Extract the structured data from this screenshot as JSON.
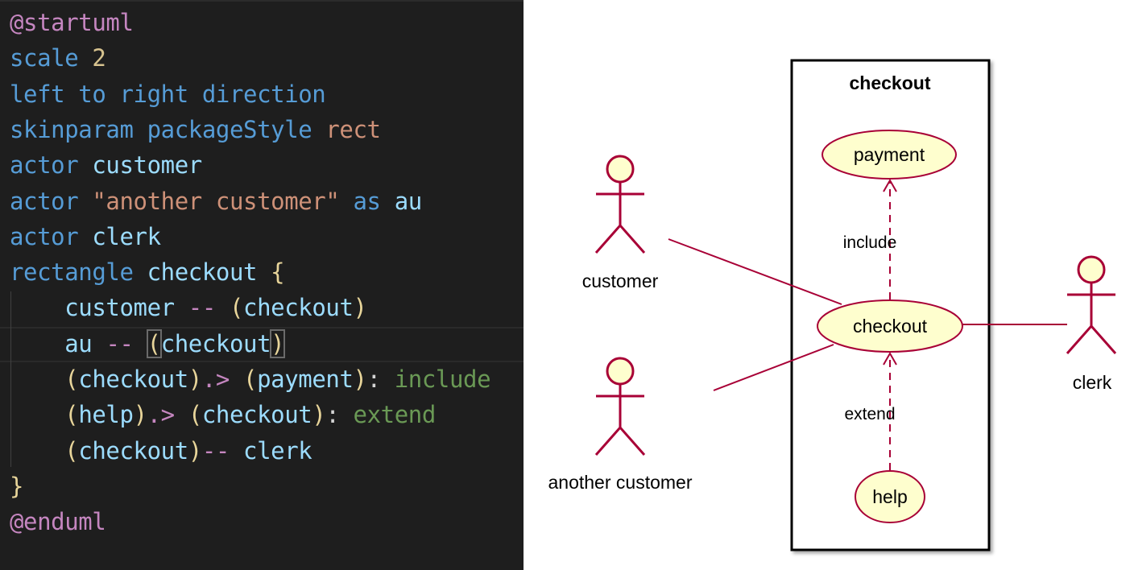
{
  "editor": {
    "lines": [
      [
        [
          "a",
          "@startuml"
        ]
      ],
      [
        [
          "k",
          "scale "
        ],
        [
          "n",
          "2"
        ]
      ],
      [
        [
          "k",
          "left to right direction"
        ]
      ],
      [
        [
          "k",
          "skinparam packageStyle "
        ],
        [
          "s",
          "rect"
        ]
      ],
      [
        [
          "k",
          "actor "
        ],
        [
          "v",
          "customer"
        ]
      ],
      [
        [
          "k",
          "actor "
        ],
        [
          "s",
          "\"another customer\" "
        ],
        [
          "k",
          "as "
        ],
        [
          "v",
          "au"
        ]
      ],
      [
        [
          "k",
          "actor "
        ],
        [
          "v",
          "clerk"
        ]
      ],
      [
        [
          "k",
          "rectangle "
        ],
        [
          "v",
          "checkout "
        ],
        [
          "p",
          "{"
        ]
      ],
      [
        [
          "w",
          "    "
        ],
        [
          "v",
          "customer "
        ],
        [
          "o",
          "-- "
        ],
        [
          "p",
          "("
        ],
        [
          "v",
          "checkout"
        ],
        [
          "p",
          ")"
        ]
      ],
      [
        [
          "w",
          "    "
        ],
        [
          "v",
          "au "
        ],
        [
          "o",
          "-- "
        ],
        [
          "p",
          "(",
          "bm"
        ],
        [
          "v",
          "checkout"
        ],
        [
          "p",
          ")",
          "bm"
        ]
      ],
      [
        [
          "w",
          "    "
        ],
        [
          "p",
          "("
        ],
        [
          "v",
          "checkout"
        ],
        [
          "p",
          ")"
        ],
        [
          "o",
          ".> "
        ],
        [
          "p",
          "("
        ],
        [
          "v",
          "payment"
        ],
        [
          "p",
          ")"
        ],
        [
          "w",
          ": "
        ],
        [
          "g",
          "include"
        ]
      ],
      [
        [
          "w",
          "    "
        ],
        [
          "p",
          "("
        ],
        [
          "v",
          "help"
        ],
        [
          "p",
          ")"
        ],
        [
          "o",
          ".> "
        ],
        [
          "p",
          "("
        ],
        [
          "v",
          "checkout"
        ],
        [
          "p",
          ")"
        ],
        [
          "w",
          ": "
        ],
        [
          "g",
          "extend"
        ]
      ],
      [
        [
          "w",
          "    "
        ],
        [
          "p",
          "("
        ],
        [
          "v",
          "checkout"
        ],
        [
          "p",
          ")"
        ],
        [
          "o",
          "-- "
        ],
        [
          "v",
          "clerk"
        ]
      ],
      [
        [
          "p",
          "}"
        ]
      ],
      [
        [
          "a",
          "@enduml"
        ]
      ]
    ]
  },
  "diagram": {
    "rectangle_title": "checkout",
    "usecases": {
      "payment": "payment",
      "checkout": "checkout",
      "help": "help"
    },
    "actors": {
      "customer": "customer",
      "another": "another customer",
      "clerk": "clerk"
    },
    "relations": {
      "include": "include",
      "extend": "extend"
    },
    "colors": {
      "line": "#a80036",
      "fill": "#fefece"
    }
  }
}
